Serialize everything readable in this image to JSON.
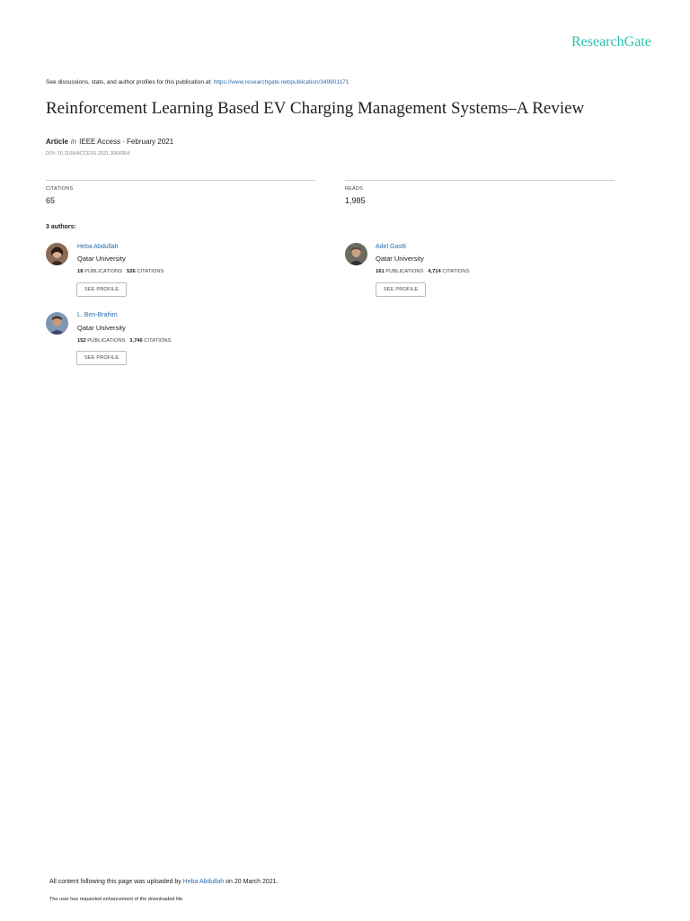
{
  "brand": {
    "logo_text": "ResearchGate",
    "color": "#25c2ad"
  },
  "header": {
    "discussion_prefix": "See discussions, stats, and author profiles for this publication at: ",
    "publication_link": "https://www.researchgate.net/publication/349901171"
  },
  "article": {
    "title": "Reinforcement Learning Based EV Charging Management Systems–A Review",
    "type": "Article",
    "in_label": "in",
    "venue": "IEEE Access · February 2021",
    "doi": "DOI: 10.1109/ACCESS.2021.3064354"
  },
  "stats": {
    "citations_label": "CITATIONS",
    "citations_value": "65",
    "reads_label": "READS",
    "reads_value": "1,985"
  },
  "authors_count_label": "3 authors:",
  "authors": [
    {
      "name": "Heba Abdullah",
      "affiliation": "Qatar University",
      "publications": "18",
      "publications_label": "PUBLICATIONS",
      "citations": "526",
      "citations_label": "CITATIONS",
      "button": "SEE PROFILE"
    },
    {
      "name": "Adel Gastli",
      "affiliation": "Qatar University",
      "publications": "161",
      "publications_label": "PUBLICATIONS",
      "citations": "4,714",
      "citations_label": "CITATIONS",
      "button": "SEE PROFILE"
    },
    {
      "name": "L. Ben-Brahim",
      "affiliation": "Qatar University",
      "publications": "152",
      "publications_label": "PUBLICATIONS",
      "citations": "3,746",
      "citations_label": "CITATIONS",
      "button": "SEE PROFILE"
    }
  ],
  "footer": {
    "uploaded_prefix": "All content following this page was uploaded by ",
    "uploader": "Heba Abdullah",
    "uploaded_suffix": " on 20 March 2021.",
    "enhancement_note": "The user has requested enhancement of the downloaded file."
  }
}
